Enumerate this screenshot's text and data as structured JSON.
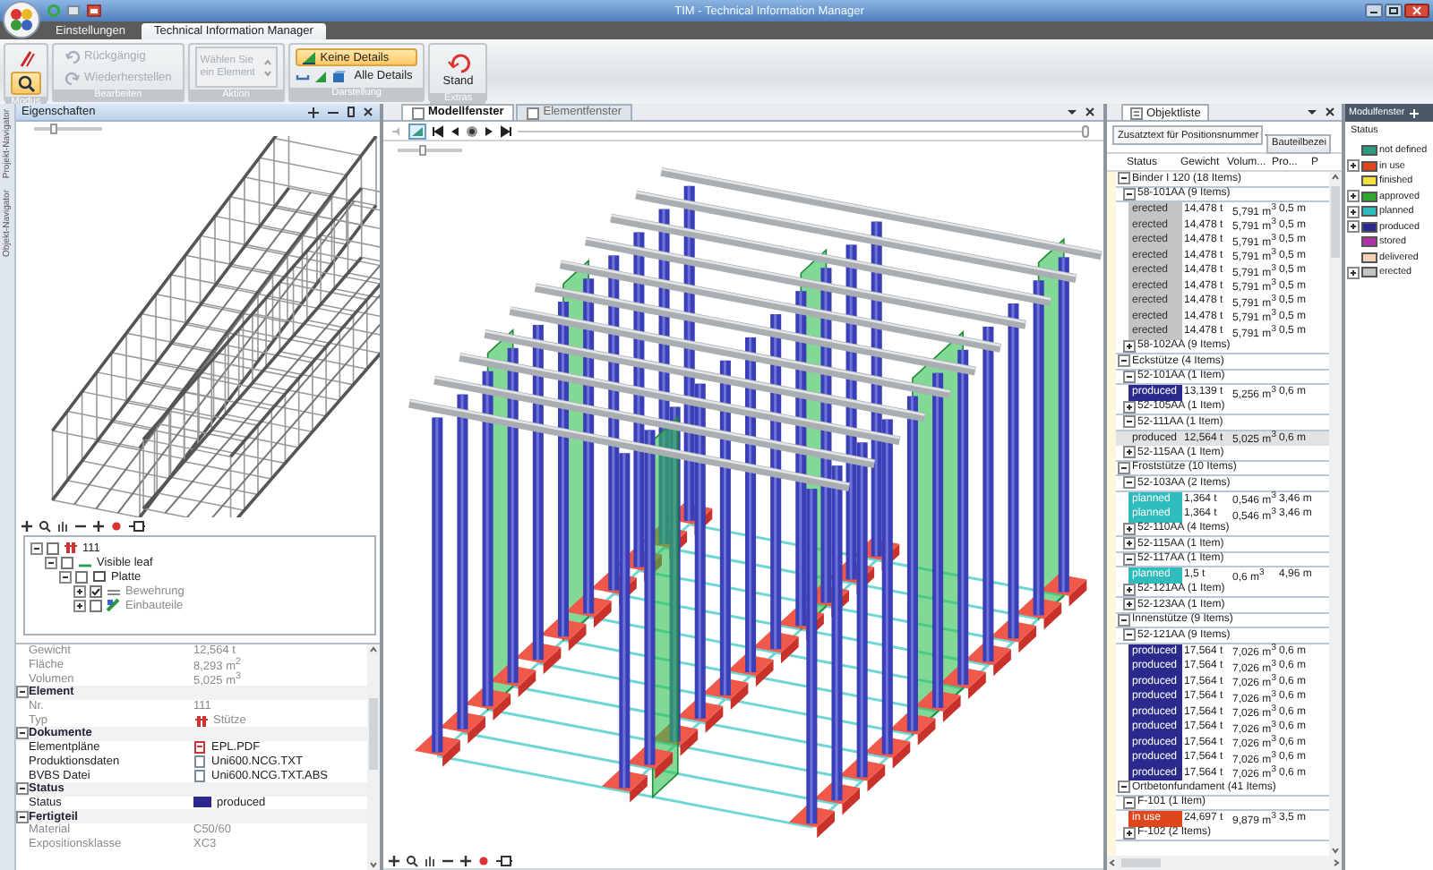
{
  "window": {
    "title": "TIM - Technical Information Manager"
  },
  "ribbon": {
    "tabs": [
      {
        "label": "Einstellungen",
        "selected": false
      },
      {
        "label": "Technical Information Manager",
        "selected": true
      }
    ],
    "groups": [
      {
        "label": "Modus",
        "items": [
          {
            "kind": "pencil",
            "selected": false
          },
          {
            "kind": "magnifier",
            "selected": true
          }
        ]
      },
      {
        "label": "Bearbeiten",
        "items": [
          {
            "kind": "undo",
            "label": "Rückgängig",
            "disabled": true
          },
          {
            "kind": "redo",
            "label": "Wiederherstellen",
            "disabled": true
          }
        ]
      },
      {
        "label": "Aktion",
        "items": [
          {
            "kind": "combo",
            "label": "Wählen Sie ein Element",
            "disabled": true
          }
        ]
      },
      {
        "label": "Darstellung",
        "items": [
          {
            "kind": "toggle",
            "label": "Keine Details",
            "selected": true
          },
          {
            "kind": "toggle-row",
            "label": "Alle Details",
            "selected": false
          }
        ]
      },
      {
        "label": "Extras",
        "items": [
          {
            "kind": "large",
            "label": "Stand"
          }
        ]
      }
    ]
  },
  "properties": {
    "title": "Eigenschaften",
    "side_tabs": [
      "Projekt-Navigator",
      "Objekt-Navigator"
    ],
    "zoom_slider": {
      "level": 0.3
    },
    "tree": [
      {
        "label": "111",
        "expanded": true,
        "checked": false,
        "disabled": false,
        "children": [
          {
            "label": "Visible leaf",
            "expanded": true,
            "checked": false,
            "disabled": false,
            "children": [
              {
                "label": "Platte",
                "expanded": true,
                "checked": false,
                "disabled": false,
                "children": [
                  {
                    "label": "Bewehrung",
                    "expanded": false,
                    "checked": true,
                    "disabled": true
                  },
                  {
                    "label": "Einbauteile",
                    "expanded": false,
                    "checked": false,
                    "disabled": true
                  }
                ]
              }
            ]
          }
        ]
      }
    ],
    "grid": [
      {
        "kind": "value",
        "label": "Gewicht",
        "value": "12,564 t",
        "disabled": true
      },
      {
        "kind": "value",
        "label": "Fläche",
        "value": "8,293 m$^{2}$",
        "disabled": true
      },
      {
        "kind": "value",
        "label": "Volumen",
        "value": "5,025 m$^{3}$",
        "disabled": true
      },
      {
        "kind": "category",
        "label": "Element",
        "expanded": true
      },
      {
        "kind": "value",
        "label": "Nr.",
        "value": "111",
        "disabled": true
      },
      {
        "kind": "type",
        "label": "Typ",
        "value": "Stütze",
        "disabled": true
      },
      {
        "kind": "category",
        "label": "Dokumente",
        "expanded": true
      },
      {
        "kind": "pdf",
        "label": "Elementpläne",
        "value": "EPL.PDF",
        "disabled": false
      },
      {
        "kind": "file",
        "label": "Produktionsdaten",
        "value": "Uni600.NCG.TXT",
        "disabled": false
      },
      {
        "kind": "file",
        "label": "BVBS Datei",
        "value": "Uni600.NCG.TXT.ABS",
        "disabled": false
      },
      {
        "kind": "category",
        "label": "Status",
        "expanded": true
      },
      {
        "kind": "swatch",
        "label": "Status",
        "value": "produced",
        "color": "#2b2a8c",
        "disabled": false
      },
      {
        "kind": "category",
        "label": "Fertigteil",
        "expanded": true
      },
      {
        "kind": "value",
        "label": "Material",
        "value": "C50/60",
        "disabled": true
      },
      {
        "kind": "value",
        "label": "Expositionsklasse",
        "value": "XC3",
        "disabled": true
      }
    ]
  },
  "model_view": {
    "tabs": [
      {
        "label": "Modellfenster",
        "selected": true
      },
      {
        "label": "Elementfenster",
        "selected": false
      }
    ],
    "zoom_slider": {
      "level": 0.4
    },
    "timeline": {
      "level": 1
    }
  },
  "object_list": {
    "title": "Objektliste",
    "filter": "Zusatztext für Positionsnummer",
    "button": "Bauteilbezei",
    "columns": [
      "Status",
      "Gewicht",
      "Volum...",
      "Pro...",
      "P"
    ],
    "groups": [
      {
        "label": "Binder I 120 (18 Items)",
        "expanded": true,
        "children": [
          {
            "label": "58-101AA (9 Items)",
            "expanded": true,
            "rows": [
              {
                "status": "erected",
                "color": "#c4c4c4",
                "selected": false,
                "weight": "14,478 t",
                "volume": "5,791 m$^{3}$",
                "length": "0,5 m"
              },
              {
                "status": "erected",
                "color": "#c4c4c4",
                "selected": false,
                "weight": "14,478 t",
                "volume": "5,791 m$^{3}$",
                "length": "0,5 m"
              },
              {
                "status": "erected",
                "color": "#c4c4c4",
                "selected": false,
                "weight": "14,478 t",
                "volume": "5,791 m$^{3}$",
                "length": "0,5 m"
              },
              {
                "status": "erected",
                "color": "#c4c4c4",
                "selected": false,
                "weight": "14,478 t",
                "volume": "5,791 m$^{3}$",
                "length": "0,5 m"
              },
              {
                "status": "erected",
                "color": "#c4c4c4",
                "selected": false,
                "weight": "14,478 t",
                "volume": "5,791 m$^{3}$",
                "length": "0,5 m"
              },
              {
                "status": "erected",
                "color": "#c4c4c4",
                "selected": false,
                "weight": "14,478 t",
                "volume": "5,791 m$^{3}$",
                "length": "0,5 m"
              },
              {
                "status": "erected",
                "color": "#c4c4c4",
                "selected": false,
                "weight": "14,478 t",
                "volume": "5,791 m$^{3}$",
                "length": "0,5 m"
              },
              {
                "status": "erected",
                "color": "#c4c4c4",
                "selected": false,
                "weight": "14,478 t",
                "volume": "5,791 m$^{3}$",
                "length": "0,5 m"
              },
              {
                "status": "erected",
                "color": "#c4c4c4",
                "selected": false,
                "weight": "14,478 t",
                "volume": "5,791 m$^{3}$",
                "length": "0,5 m"
              }
            ]
          },
          {
            "label": "58-102AA (9 Items)",
            "expanded": false
          }
        ]
      },
      {
        "label": "Eckstütze (4 Items)",
        "expanded": true,
        "children": [
          {
            "label": "52-101AA (1 Item)",
            "expanded": true,
            "rows": [
              {
                "status": "produced",
                "color": "#2b2a8c",
                "selected": false,
                "weight": "13,139 t",
                "volume": "5,256 m$^{3}$",
                "length": "0,6 m"
              }
            ]
          },
          {
            "label": "52-105AA (1 Item)",
            "expanded": false
          },
          {
            "label": "52-111AA (1 Item)",
            "expanded": true,
            "rows": [
              {
                "status": "produced",
                "selected": true,
                "weight": "12,564 t",
                "volume": "5,025 m$^{3}$",
                "length": "0,6 m"
              }
            ]
          },
          {
            "label": "52-115AA (1 Item)",
            "expanded": false
          }
        ]
      },
      {
        "label": "Froststütze (10 Items)",
        "expanded": true,
        "children": [
          {
            "label": "52-103AA (2 Items)",
            "expanded": true,
            "rows": [
              {
                "status": "planned",
                "color": "#2fbcbc",
                "selected": false,
                "weight": "1,364 t",
                "volume": "0,546 m$^{3}$",
                "length": "3,46 m"
              },
              {
                "status": "planned",
                "color": "#2fbcbc",
                "selected": false,
                "weight": "1,364 t",
                "volume": "0,546 m$^{3}$",
                "length": "3,46 m"
              }
            ]
          },
          {
            "label": "52-110AA (4 Items)",
            "expanded": false
          },
          {
            "label": "52-115AA (1 Item)",
            "expanded": false
          },
          {
            "label": "52-117AA (1 Item)",
            "expanded": true,
            "rows": [
              {
                "status": "planned",
                "color": "#2fbcbc",
                "selected": false,
                "weight": "1,5 t",
                "volume": "0,6 m$^{3}$",
                "length": "4,96 m"
              }
            ]
          },
          {
            "label": "52-121AA (1 Item)",
            "expanded": false
          },
          {
            "label": "52-123AA (1 Item)",
            "expanded": false
          }
        ]
      },
      {
        "label": "Innenstütze (9 Items)",
        "expanded": true,
        "children": [
          {
            "label": "52-121AA (9 Items)",
            "expanded": true,
            "rows": [
              {
                "status": "produced",
                "color": "#2b2a8c",
                "selected": false,
                "weight": "17,564 t",
                "volume": "7,026 m$^{3}$",
                "length": "0,6 m"
              },
              {
                "status": "produced",
                "color": "#2b2a8c",
                "selected": false,
                "weight": "17,564 t",
                "volume": "7,026 m$^{3}$",
                "length": "0,6 m"
              },
              {
                "status": "produced",
                "color": "#2b2a8c",
                "selected": false,
                "weight": "17,564 t",
                "volume": "7,026 m$^{3}$",
                "length": "0,6 m"
              },
              {
                "status": "produced",
                "color": "#2b2a8c",
                "selected": false,
                "weight": "17,564 t",
                "volume": "7,026 m$^{3}$",
                "length": "0,6 m"
              },
              {
                "status": "produced",
                "color": "#2b2a8c",
                "selected": false,
                "weight": "17,564 t",
                "volume": "7,026 m$^{3}$",
                "length": "0,6 m"
              },
              {
                "status": "produced",
                "color": "#2b2a8c",
                "selected": false,
                "weight": "17,564 t",
                "volume": "7,026 m$^{3}$",
                "length": "0,6 m"
              },
              {
                "status": "produced",
                "color": "#2b2a8c",
                "selected": false,
                "weight": "17,564 t",
                "volume": "7,026 m$^{3}$",
                "length": "0,6 m"
              },
              {
                "status": "produced",
                "color": "#2b2a8c",
                "selected": false,
                "weight": "17,564 t",
                "volume": "7,026 m$^{3}$",
                "length": "0,6 m"
              },
              {
                "status": "produced",
                "color": "#2b2a8c",
                "selected": false,
                "weight": "17,564 t",
                "volume": "7,026 m$^{3}$",
                "length": "0,6 m"
              }
            ]
          }
        ]
      },
      {
        "label": "Ortbetonfundament (41 Items)",
        "expanded": true,
        "children": [
          {
            "label": "F-101 (1 Item)",
            "expanded": true,
            "rows": [
              {
                "status": "in use",
                "color": "#e0461c",
                "selected": false,
                "weight": "24,697 t",
                "volume": "9,879 m$^{3}$",
                "length": "3,5 m"
              }
            ]
          },
          {
            "label": "F-102 (2 Items)",
            "expanded": false
          }
        ]
      }
    ]
  },
  "legend": {
    "title": "Modulfenster",
    "heading": "Status",
    "items": [
      {
        "label": "not defined",
        "color": "#2a9a80",
        "collapsed": false
      },
      {
        "label": "in use",
        "color": "#e0461c",
        "collapsed": true
      },
      {
        "label": "finished",
        "color": "#f0e040",
        "collapsed": false
      },
      {
        "label": "approved",
        "color": "#30a830",
        "collapsed": true
      },
      {
        "label": "planned",
        "color": "#2fbcbc",
        "collapsed": true
      },
      {
        "label": "produced",
        "color": "#2b2a8c",
        "collapsed": true
      },
      {
        "label": "stored",
        "color": "#b030a8",
        "collapsed": false
      },
      {
        "label": "delivered",
        "color": "#f6d2b4",
        "collapsed": false
      },
      {
        "label": "erected",
        "color": "#c4c4c4",
        "collapsed": true
      }
    ]
  }
}
